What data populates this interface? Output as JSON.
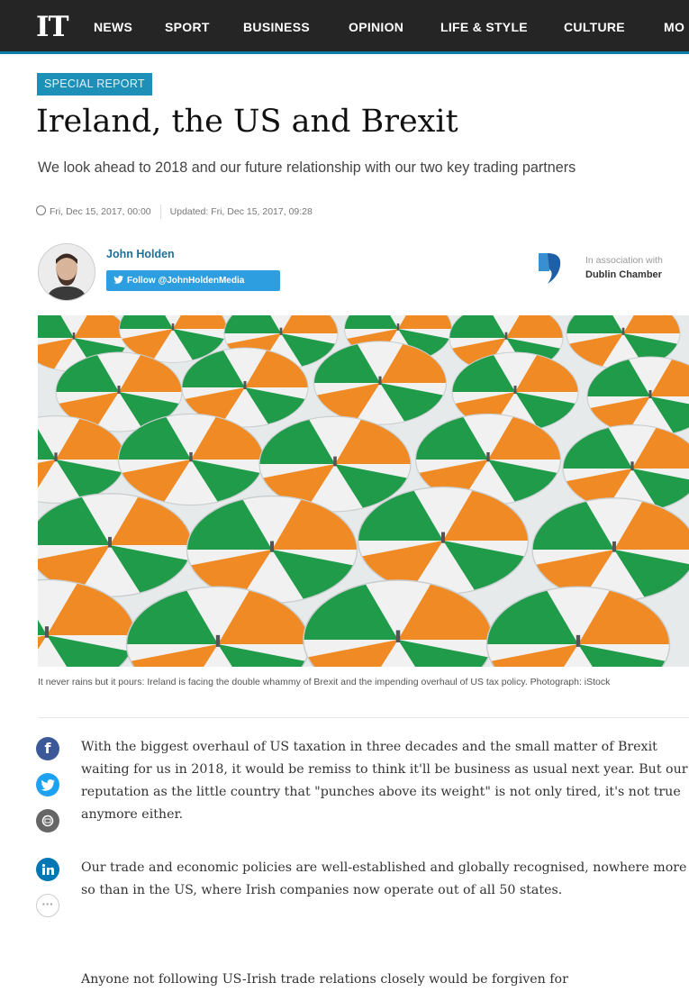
{
  "nav": {
    "logo": "IT",
    "items": [
      "NEWS",
      "SPORT",
      "BUSINESS",
      "OPINION",
      "LIFE & STYLE",
      "CULTURE",
      "MO"
    ]
  },
  "article": {
    "badge": "SPECIAL REPORT",
    "title": "Ireland, the US and Brexit",
    "standfirst": "We look ahead to 2018 and our future relationship with our two key trading partners",
    "published": "Fri, Dec 15, 2017, 00:00",
    "updated": "Updated: Fri, Dec 15, 2017, 09:28",
    "author": {
      "name": "John Holden",
      "follow_label": "Follow @JohnHoldenMedia"
    },
    "association": {
      "label": "In association with",
      "name": "Dublin Chamber"
    },
    "caption": "It never rains but it pours: Ireland is facing the double whammy of Brexit and the impending overhaul of US tax policy. Photograph: iStock",
    "paragraphs": [
      "With the biggest overhaul of US taxation in three decades and the small matter of Brexit waiting for us in 2018, it would be remiss to think it'll be business as usual next year. But our reputation as the little country that \"punches above its weight\" is not only tired, it's not true anymore either.",
      "Our trade and economic policies are well-established and globally recognised, nowhere more so than in the US, where Irish companies now operate out of all 50 states.",
      "Anyone not following US-Irish trade relations closely would be forgiven for"
    ]
  },
  "share": {
    "facebook_glyph": "f",
    "more_glyph": "···"
  },
  "colors": {
    "accent": "#1e8fb7",
    "green": "#1f9b4a",
    "orange": "#f08a24",
    "nav_bg": "#252525"
  }
}
